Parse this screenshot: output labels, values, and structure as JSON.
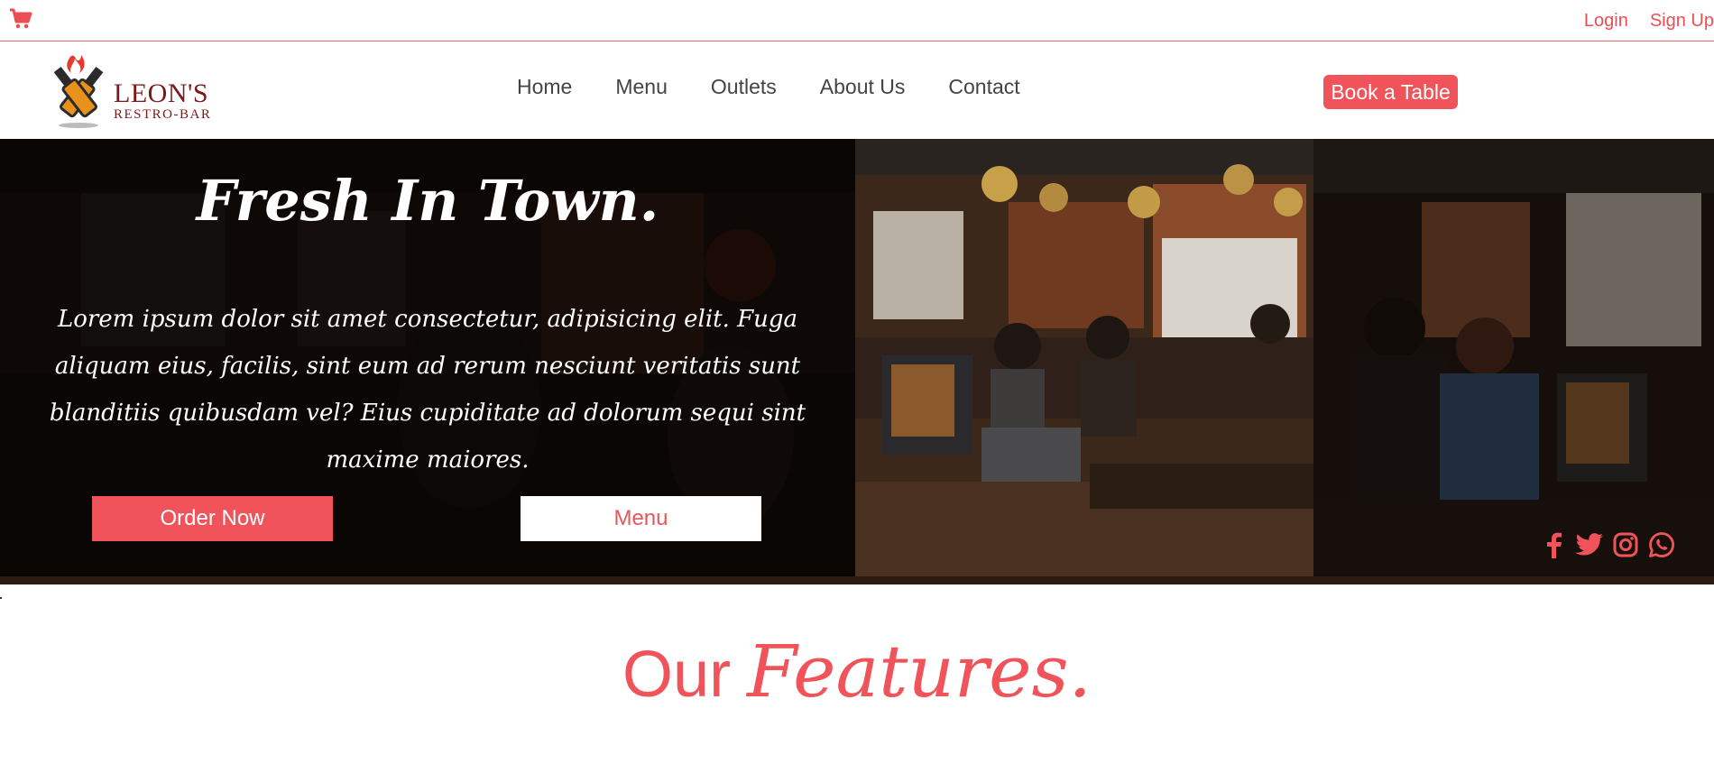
{
  "topbar": {
    "cart_icon": "shopping-cart-icon",
    "login_label": "Login",
    "signup_label": "Sign Up"
  },
  "brand": {
    "name": "LEON'S",
    "tagline": "RESTRO-BAR"
  },
  "nav": {
    "items": [
      {
        "label": "Home"
      },
      {
        "label": "Menu"
      },
      {
        "label": "Outlets"
      },
      {
        "label": "About Us"
      },
      {
        "label": "Contact"
      }
    ],
    "cta_label": "Book a Table"
  },
  "hero": {
    "title": "Fresh In Town.",
    "text": "Lorem ipsum dolor sit amet consectetur, adipisicing elit. Fuga aliquam eius, facilis, sint eum ad rerum nesciunt veritatis sunt blanditiis quibusdam vel? Eius cupiditate ad dolorum sequi sint maxime maiores.",
    "order_label": "Order Now",
    "menu_label": "Menu",
    "socials": [
      "facebook-icon",
      "twitter-icon",
      "instagram-icon",
      "whatsapp-icon"
    ]
  },
  "features": {
    "heading_plain": "Our",
    "heading_script": "Features."
  },
  "colors": {
    "accent": "#f0545a",
    "brand_dark": "#7a1a1a",
    "nav_text": "#444444"
  }
}
